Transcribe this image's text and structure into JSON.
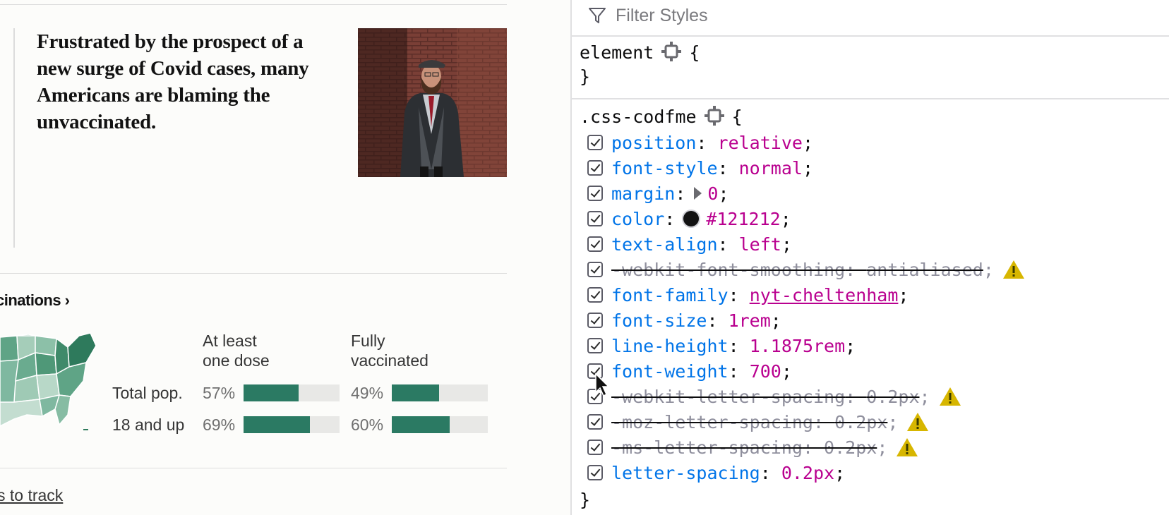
{
  "article": {
    "headline": "Frustrated by the prospect of a new surge of Covid cases, many Americans are blaming the unvaccinated.",
    "photo_alt": "Portrait of a man in a flat cap and suit standing against a brick wall"
  },
  "vaccinations": {
    "title": "cinations ›",
    "col_at_least": "At least\none dose",
    "col_fully": "Fully\nvaccinated",
    "rows": [
      {
        "label": "Total pop.",
        "at_least_pct": "57%",
        "at_least_value": 57,
        "fully_pct": "49%",
        "fully_value": 49
      },
      {
        "label": "18 and up",
        "at_least_pct": "69%",
        "at_least_value": 69,
        "fully_pct": "60%",
        "fully_value": 60
      }
    ],
    "colors": {
      "bar": "#2b7a63",
      "track": "#e8e8e6"
    }
  },
  "footer_link": "s to track",
  "devtools": {
    "filter_placeholder": "Filter Styles",
    "filter_icon": "funnel-icon",
    "element_rule": {
      "selector": "element",
      "open": "{",
      "close": "}"
    },
    "class_rule": {
      "selector": ".css-codfme",
      "open": "{",
      "close": "}",
      "declarations": [
        {
          "name": "position",
          "value": "relative",
          "overridden": false
        },
        {
          "name": "font-style",
          "value": "normal",
          "overridden": false
        },
        {
          "name": "margin",
          "value": "0",
          "overridden": false,
          "expander": true
        },
        {
          "name": "color",
          "value": "#121212",
          "overridden": false,
          "swatch": "#121212"
        },
        {
          "name": "text-align",
          "value": "left",
          "overridden": false
        },
        {
          "name": "-webkit-font-smoothing",
          "value": "antialiased",
          "overridden": true,
          "warning": true
        },
        {
          "name": "font-family",
          "value": "nyt-cheltenham",
          "overridden": false,
          "link": true
        },
        {
          "name": "font-size",
          "value": "1rem",
          "overridden": false
        },
        {
          "name": "line-height",
          "value": "1.1875rem",
          "overridden": false
        },
        {
          "name": "font-weight",
          "value": "700",
          "overridden": false
        },
        {
          "name": "-webkit-letter-spacing",
          "value": "0.2px",
          "overridden": true,
          "warning": true
        },
        {
          "name": "-moz-letter-spacing",
          "value": "0.2px",
          "overridden": true,
          "warning": true
        },
        {
          "name": "-ms-letter-spacing",
          "value": "0.2px",
          "overridden": true,
          "warning": true
        },
        {
          "name": "letter-spacing",
          "value": "0.2px",
          "overridden": false
        }
      ]
    },
    "colors": {
      "property": "#0074e8",
      "value": "#b9008f",
      "warning": "#d7b600"
    }
  }
}
